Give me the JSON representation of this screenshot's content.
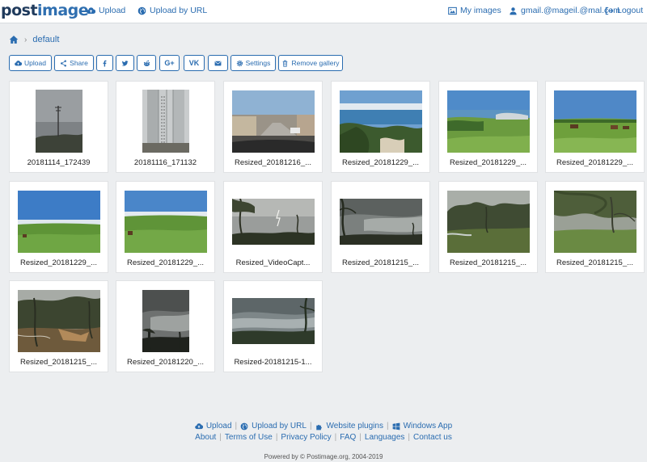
{
  "header": {
    "logo": "postimage",
    "nav_left": [
      {
        "label": "Upload",
        "icon": "cloud-upload-icon"
      },
      {
        "label": "Upload by URL",
        "icon": "globe-icon"
      }
    ],
    "nav_right": [
      {
        "label": "My images",
        "icon": "image-icon"
      },
      {
        "label": "gmail.@mageil.@mal.com",
        "icon": "user-icon"
      },
      {
        "label": "Logout",
        "icon": "logout-icon"
      }
    ]
  },
  "breadcrumb": {
    "home_icon": "home-icon",
    "current": "default"
  },
  "toolbar": {
    "upload": "Upload",
    "share": "Share",
    "google_plus": "G+",
    "vk": "VK",
    "settings": "Settings",
    "remove_gallery": "Remove gallery"
  },
  "gallery": {
    "items": [
      {
        "caption": "20181114_172439"
      },
      {
        "caption": "20181116_171132"
      },
      {
        "caption": "Resized_20181216_..."
      },
      {
        "caption": "Resized_20181229_..."
      },
      {
        "caption": "Resized_20181229_..."
      },
      {
        "caption": "Resized_20181229_..."
      },
      {
        "caption": "Resized_20181229_..."
      },
      {
        "caption": "Resized_20181229_..."
      },
      {
        "caption": "Resized_VideoCapt..."
      },
      {
        "caption": "Resized_20181215_..."
      },
      {
        "caption": "Resized_20181215_..."
      },
      {
        "caption": "Resized_20181215_..."
      },
      {
        "caption": "Resized_20181215_..."
      },
      {
        "caption": "Resized_20181220_..."
      },
      {
        "caption": "Resized-20181215-1..."
      }
    ]
  },
  "footer": {
    "row1": [
      "Upload",
      "Upload by URL",
      "Website plugins",
      "Windows App"
    ],
    "row2": [
      "About",
      "Terms of Use",
      "Privacy Policy",
      "FAQ",
      "Languages",
      "Contact us"
    ],
    "powered": "Powered by © Postimage.org, 2004-2019"
  },
  "colors": {
    "link": "#2a6cb0",
    "background": "#eceef0"
  }
}
